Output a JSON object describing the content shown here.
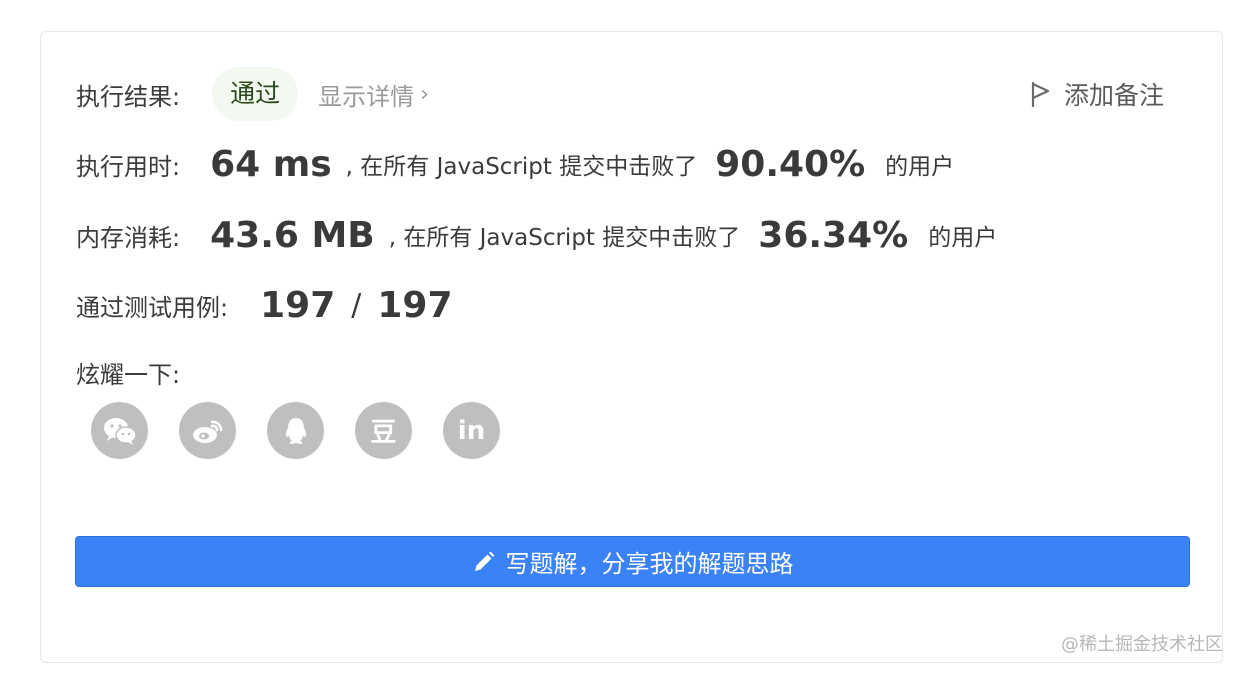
{
  "result": {
    "label": "执行结果:",
    "status": "通过",
    "details_link": "显示详情",
    "details_chevron": "›",
    "add_note": "添加备注"
  },
  "runtime": {
    "label": "执行用时:",
    "value": "64 ms",
    "mid_text": ", 在所有 JavaScript 提交中击败了",
    "percent": "90.40%",
    "suffix": "的用户"
  },
  "memory": {
    "label": "内存消耗:",
    "value": "43.6 MB",
    "mid_text": ", 在所有 JavaScript 提交中击败了",
    "percent": "36.34%",
    "suffix": "的用户"
  },
  "tests": {
    "label": "通过测试用例:",
    "passed": "197",
    "separator": "/",
    "total": "197"
  },
  "share": {
    "label": "炫耀一下:",
    "icons": [
      "wechat-icon",
      "weibo-icon",
      "qq-icon",
      "douban-icon",
      "linkedin-icon"
    ],
    "douban_glyph": "豆",
    "linkedin_glyph": "in"
  },
  "write_button": {
    "label": "写题解，分享我的解题思路"
  },
  "colors": {
    "accent": "#3b82f6",
    "pass_bg": "#f3f9f1",
    "icon_gray": "#bfbfbf"
  },
  "watermark": "@稀土掘金技术社区"
}
